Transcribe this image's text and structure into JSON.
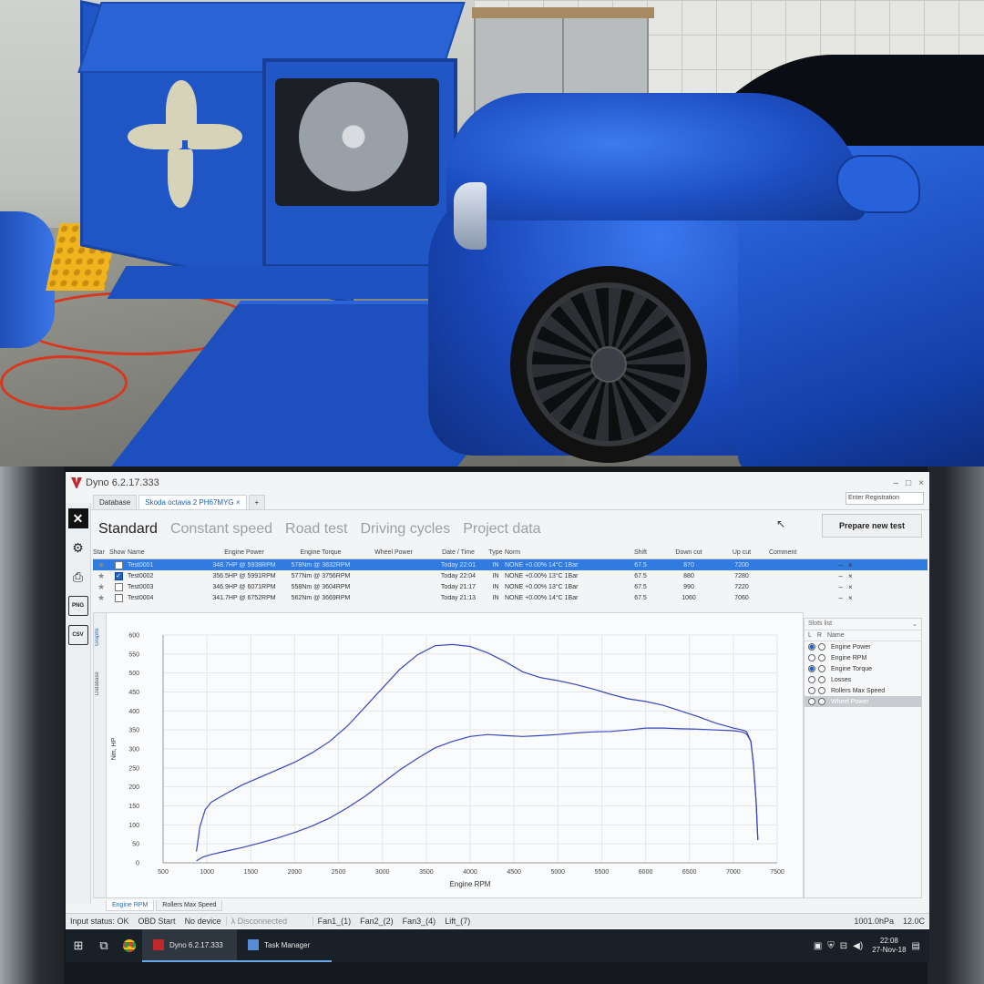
{
  "app": {
    "title": "Dyno 6.2.17.333",
    "window_controls": [
      "–",
      "□",
      "×"
    ]
  },
  "tabs": [
    {
      "label": "Database"
    },
    {
      "label": "Skoda octavia 2 PH67MYG",
      "close": "×"
    },
    {
      "label": "+"
    }
  ],
  "registration": {
    "placeholder": "Enter Registration"
  },
  "modes": [
    "Standard",
    "Constant speed",
    "Road test",
    "Driving cycles",
    "Project data"
  ],
  "prepare_button": "Prepare new test",
  "sidebar": {
    "icons": [
      "close-icon",
      "gear-icon",
      "printer-icon",
      "png-file-icon",
      "csv-file-icon"
    ],
    "png_label": "PNG",
    "csv_label": "CSV"
  },
  "table": {
    "columns": [
      "Star",
      "Show",
      "Name",
      "Engine Power",
      "Engine Torque",
      "Wheel Power",
      "Date / Time",
      "Type",
      "Norm",
      "Shift",
      "Down cut",
      "Up cut",
      "Comment"
    ],
    "rows": [
      {
        "name": "Test0001",
        "shown": false,
        "power": "348.7HP @ 5938RPM",
        "torque": "578Nm @ 3832RPM",
        "wheel": "",
        "date": "Today 22:01",
        "type": "IN",
        "norm": "NONE +0.00% 14°C 1Bar",
        "shift": "67.5",
        "down": "870",
        "up": "7200",
        "comment": "",
        "selected": true
      },
      {
        "name": "Test0002",
        "shown": true,
        "power": "356.5HP @ 5991RPM",
        "torque": "577Nm @ 3756RPM",
        "wheel": "",
        "date": "Today 22:04",
        "type": "IN",
        "norm": "NONE +0.00% 13°C 1Bar",
        "shift": "67.5",
        "down": "880",
        "up": "7280",
        "comment": "",
        "selected": false
      },
      {
        "name": "Test0003",
        "shown": false,
        "power": "346.9HP @ 6071RPM",
        "torque": "558Nm @ 3604RPM",
        "wheel": "",
        "date": "Today 21:17",
        "type": "IN",
        "norm": "NONE +0.00% 13°C 1Bar",
        "shift": "67.5",
        "down": "990",
        "up": "7220",
        "comment": "",
        "selected": false
      },
      {
        "name": "Test0004",
        "shown": false,
        "power": "341.7HP @ 6752RPM",
        "torque": "562Nm @ 3669RPM",
        "wheel": "",
        "date": "Today 21:13",
        "type": "IN",
        "norm": "NONE +0.00% 14°C 1Bar",
        "shift": "67.5",
        "down": "1060",
        "up": "7060",
        "comment": "",
        "selected": false
      }
    ],
    "row_controls": "– ×"
  },
  "graph_tabs": [
    "Graphs",
    "Database"
  ],
  "chart_data": {
    "type": "line",
    "xlabel": "Engine RPM",
    "ylabel": "Nm, HP",
    "xlim": [
      500,
      7500
    ],
    "ylim": [
      0,
      600
    ],
    "x_ticks": [
      500,
      1000,
      1500,
      2000,
      2500,
      3000,
      3500,
      4000,
      4500,
      5000,
      5500,
      6000,
      6500,
      7000,
      7500
    ],
    "y_ticks": [
      0,
      50,
      100,
      150,
      200,
      250,
      300,
      350,
      400,
      450,
      500,
      550,
      600
    ],
    "grid": true,
    "color": "#3a45c0",
    "series": [
      {
        "x": [
          880,
          920,
          980,
          1050,
          1200,
          1400,
          1600,
          1800,
          2000,
          2200,
          2400,
          2600,
          2800,
          3000,
          3200,
          3400,
          3600,
          3800,
          4000,
          4200,
          4400,
          4600,
          4800,
          5000,
          5200,
          5400,
          5600,
          5800,
          6000,
          6200,
          6400,
          6600,
          6800,
          7000,
          7100,
          7150,
          7200,
          7230,
          7260,
          7280
        ],
        "y": [
          30,
          95,
          140,
          160,
          180,
          205,
          225,
          245,
          265,
          290,
          320,
          360,
          410,
          460,
          510,
          548,
          572,
          575,
          570,
          553,
          530,
          503,
          488,
          480,
          470,
          458,
          444,
          432,
          425,
          415,
          400,
          385,
          368,
          355,
          350,
          346,
          320,
          260,
          160,
          60
        ]
      },
      {
        "x": [
          880,
          950,
          1050,
          1200,
          1400,
          1600,
          1800,
          2000,
          2200,
          2400,
          2600,
          2800,
          3000,
          3200,
          3400,
          3600,
          3800,
          4000,
          4200,
          4400,
          4600,
          4800,
          5000,
          5200,
          5400,
          5600,
          5800,
          6000,
          6200,
          6400,
          6600,
          6800,
          7000,
          7100,
          7150,
          7200,
          7230,
          7260,
          7280
        ],
        "y": [
          5,
          15,
          22,
          30,
          40,
          52,
          65,
          80,
          97,
          118,
          145,
          175,
          210,
          245,
          275,
          303,
          320,
          333,
          338,
          335,
          333,
          335,
          338,
          342,
          345,
          346,
          350,
          355,
          355,
          353,
          352,
          350,
          348,
          345,
          340,
          320,
          260,
          160,
          60
        ]
      }
    ]
  },
  "slots": {
    "title": "Slots list",
    "columns": [
      "L",
      "R",
      "Name"
    ],
    "items": [
      {
        "name": "Engine Power",
        "l": true,
        "r": false,
        "selected": false
      },
      {
        "name": "Engine RPM",
        "l": false,
        "r": false,
        "selected": false
      },
      {
        "name": "Engine Torque",
        "l": true,
        "r": false,
        "selected": false
      },
      {
        "name": "Losses",
        "l": false,
        "r": false,
        "selected": false
      },
      {
        "name": "Rollers Max Speed",
        "l": false,
        "r": false,
        "selected": false
      },
      {
        "name": "Wheel Power",
        "l": false,
        "r": false,
        "selected": true
      }
    ]
  },
  "bottom_tabs": [
    "Engine RPM",
    "Rollers Max Speed"
  ],
  "status": {
    "input": "Input status: OK",
    "obd": "OBD Start",
    "device": "No device",
    "lambda": "λ Disconnected",
    "fans": [
      "Fan1_(1)",
      "Fan2_(2)",
      "Fan3_(4)",
      "Lift_(7)"
    ],
    "pressure": "1001.0hPa",
    "temp": "12.0C"
  },
  "taskbar": {
    "apps": [
      {
        "label": "Dyno 6.2.17.333",
        "active": true
      },
      {
        "label": "Task Manager",
        "active": false
      }
    ],
    "time": "22:08",
    "date": "27-Nov-18"
  }
}
